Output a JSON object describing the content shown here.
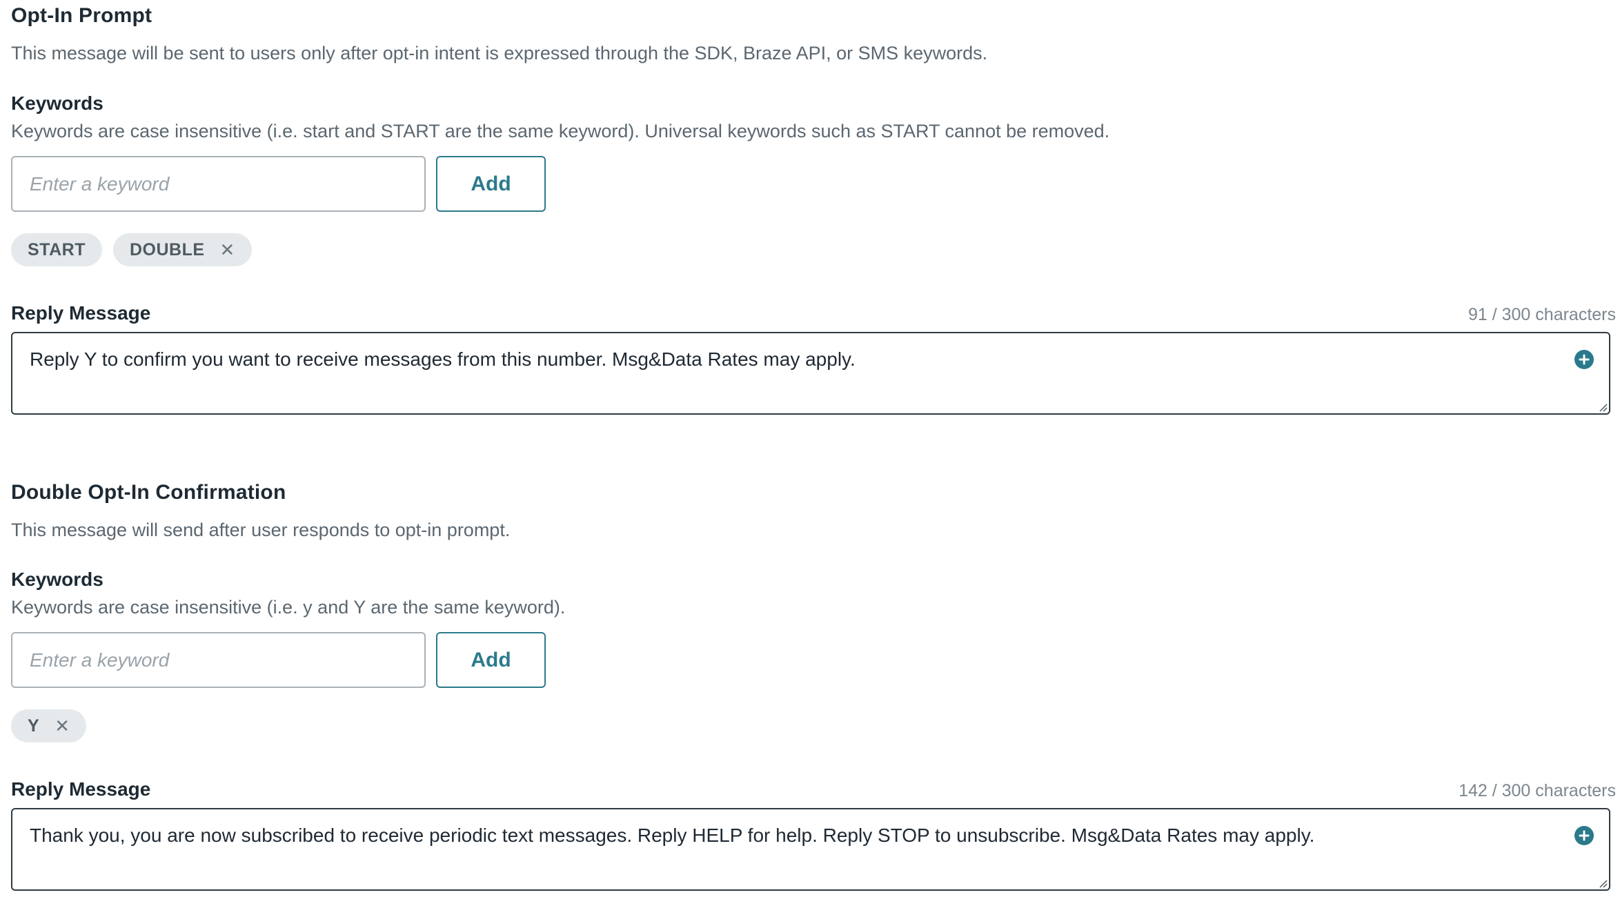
{
  "opt_in": {
    "title": "Opt-In Prompt",
    "description": "This message will be sent to users only after opt-in intent is expressed through the SDK, Braze API, or SMS keywords.",
    "keywords_label": "Keywords",
    "keywords_help": "Keywords are case insensitive (i.e. start and START are the same keyword). Universal keywords such as START cannot be removed.",
    "keyword_placeholder": "Enter a keyword",
    "add_label": "Add",
    "chips": [
      {
        "label": "START",
        "removable": false
      },
      {
        "label": "DOUBLE",
        "removable": true
      }
    ],
    "reply_label": "Reply Message",
    "reply_counter": "91 / 300 characters",
    "reply_text": "Reply Y to confirm you want to receive messages from this number. Msg&Data Rates may apply."
  },
  "double_opt_in": {
    "title": "Double Opt-In Confirmation",
    "description": "This message will send after user responds to opt-in prompt.",
    "keywords_label": "Keywords",
    "keywords_help": "Keywords are case insensitive (i.e. y and Y are the same keyword).",
    "keyword_placeholder": "Enter a keyword",
    "add_label": "Add",
    "chips": [
      {
        "label": "Y",
        "removable": true
      }
    ],
    "reply_label": "Reply Message",
    "reply_counter": "142 / 300 characters",
    "reply_text": "Thank you, you are now subscribed to receive periodic text messages. Reply HELP for help. Reply STOP to unsubscribe. Msg&Data Rates may apply."
  },
  "icons": {
    "remove": "close-icon",
    "insert": "plus-circle-icon",
    "resize": "resize-grip-icon"
  },
  "colors": {
    "accent": "#2b7a8c",
    "chip_bg": "#e6e9eb",
    "muted_text": "#5b6770"
  }
}
